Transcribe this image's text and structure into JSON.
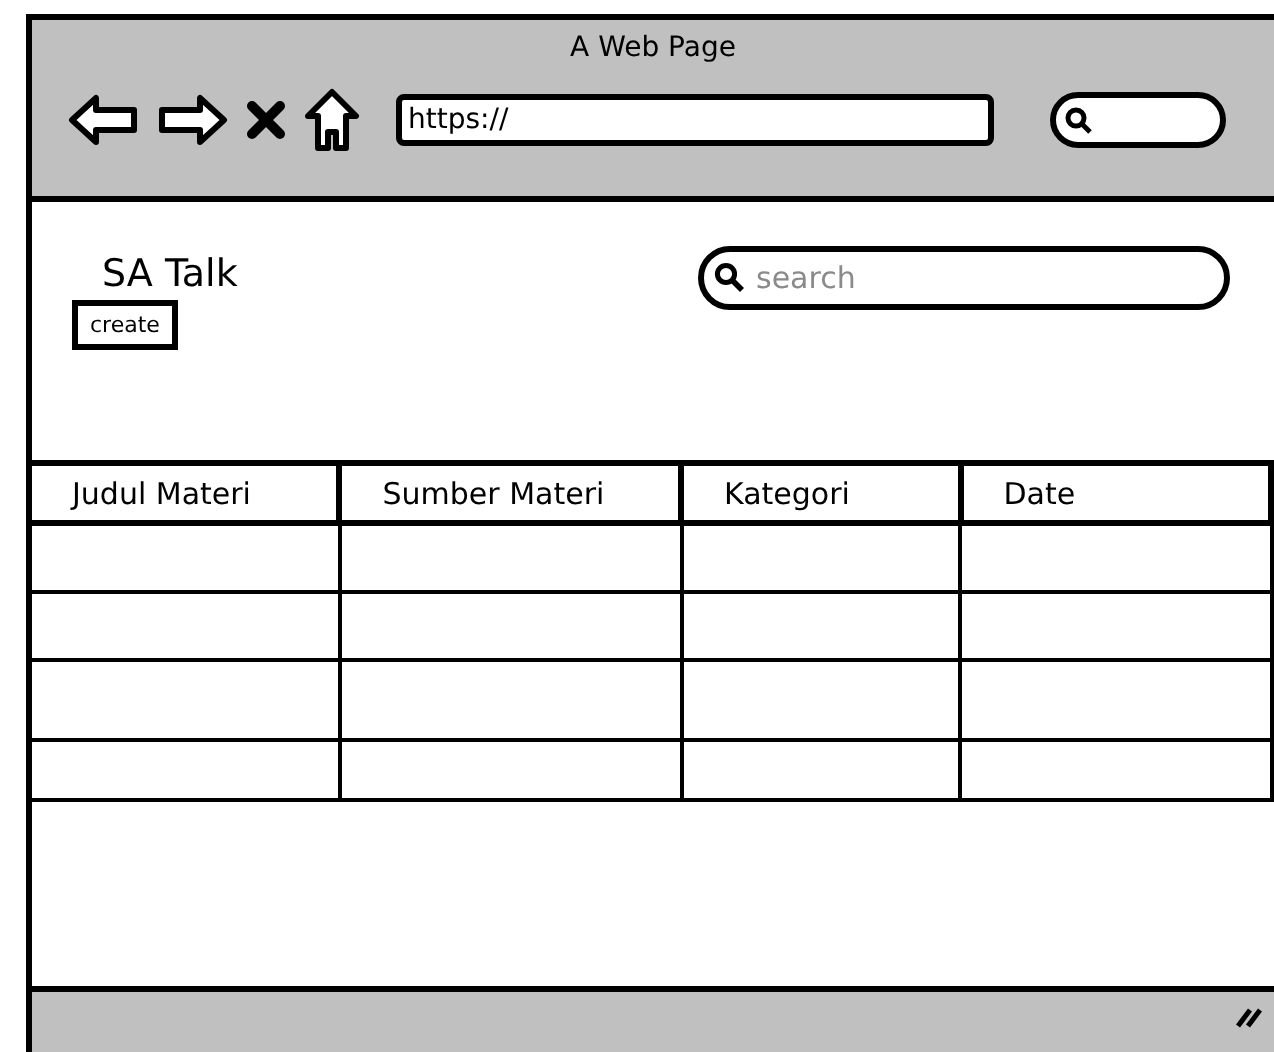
{
  "window": {
    "title": "A Web Page",
    "url": "https://"
  },
  "page": {
    "heading": "SA Talk",
    "create_button": "create",
    "search": {
      "placeholder": "search"
    }
  },
  "table": {
    "columns": [
      "Judul Materi",
      "Sumber Materi",
      "Kategori",
      "Date"
    ]
  }
}
